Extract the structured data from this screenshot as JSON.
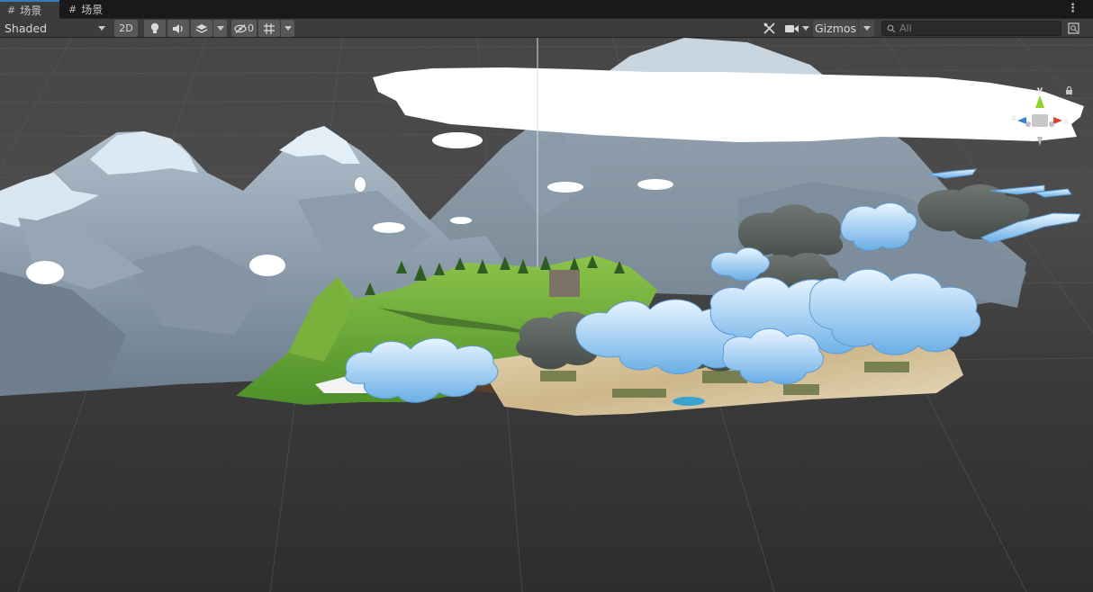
{
  "tabs": [
    {
      "label": "场景",
      "active": true
    },
    {
      "label": "场景",
      "active": false
    }
  ],
  "toolbar": {
    "shading_mode": "Shaded",
    "two_d_label": "2D",
    "hidden_count": "0",
    "gizmos_label": "Gizmos",
    "search_placeholder": "All"
  },
  "icons": [
    "hash-icon",
    "light-bulb-icon",
    "audio-icon",
    "effects-icon",
    "hidden-objects-icon",
    "grid-snap-icon",
    "tools-icon",
    "camera-icon",
    "search-icon",
    "maximize-icon",
    "more-menu-icon",
    "scene-orientation-gizmo",
    "lock-icon"
  ],
  "gizmo": {
    "y_label": "y",
    "x_label": "x",
    "z_label": "z",
    "y_color": "#8ed42a",
    "x_color": "#d8432e",
    "z_color": "#3a7fd8"
  },
  "colors": {
    "accent_tab": "#3a79bb",
    "toolbar": "#3c3c3c",
    "tabbar": "#191919"
  }
}
